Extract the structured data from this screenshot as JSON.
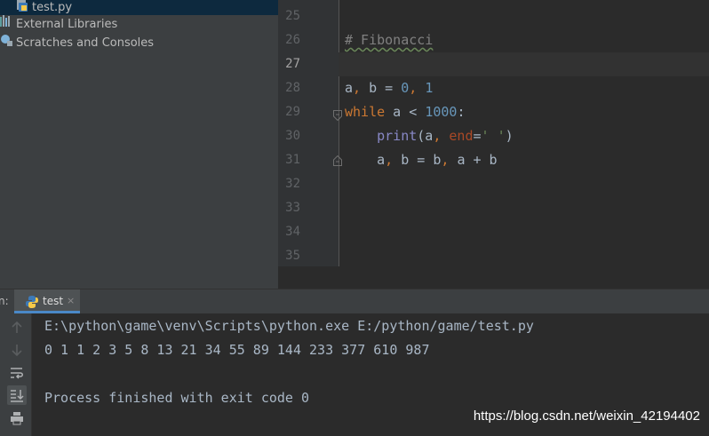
{
  "project": {
    "items": [
      {
        "label": "test.py"
      },
      {
        "label": "External Libraries"
      },
      {
        "label": "Scratches and Consoles"
      }
    ]
  },
  "editor": {
    "line_numbers": [
      "25",
      "26",
      "27",
      "28",
      "29",
      "30",
      "31",
      "32",
      "33",
      "34",
      "35"
    ],
    "current_line": "27",
    "code": {
      "comment": "# Fibonacci",
      "l28": {
        "a": "a",
        "sep1": ", ",
        "b": "b",
        "eq": " = ",
        "n0": "0",
        "sep2": ", ",
        "n1": "1"
      },
      "l29": {
        "kw": "while",
        "cond": " a < ",
        "num": "1000",
        "colon": ":"
      },
      "l30": {
        "indent": "    ",
        "fn": "print",
        "open": "(a",
        "sep": ", ",
        "param": "end",
        "eq": "=",
        "str": "' '",
        "close": ")"
      },
      "l31": {
        "indent": "    ",
        "a": "a",
        "sep1": ", ",
        "b": "b",
        "eq": " = ",
        "b2": "b",
        "sep2": ", ",
        "expr": "a + b"
      }
    }
  },
  "run": {
    "label": "n:",
    "tab_label": "test",
    "tab_close": "×",
    "output": [
      "E:\\python\\game\\venv\\Scripts\\python.exe E:/python/game/test.py",
      "0 1 1 2 3 5 8 13 21 34 55 89 144 233 377 610 987",
      "",
      "Process finished with exit code 0"
    ]
  },
  "watermark": "https://blog.csdn.net/weixin_42194402",
  "icons": {
    "project": [
      "python-file-icon",
      "libraries-icon",
      "scratches-icon"
    ],
    "toolbar": [
      "up-arrow-icon",
      "down-arrow-icon",
      "soft-wrap-icon",
      "scroll-to-end-icon",
      "print-icon"
    ]
  },
  "colors": {
    "background": "#2b2b2b",
    "panel": "#3c3f41",
    "keyword": "#cc7832",
    "number": "#6897bb",
    "string": "#6a8759",
    "builtin": "#8888c6",
    "param": "#aa4926",
    "comment": "#808080",
    "tab_underline": "#4a88c7"
  }
}
